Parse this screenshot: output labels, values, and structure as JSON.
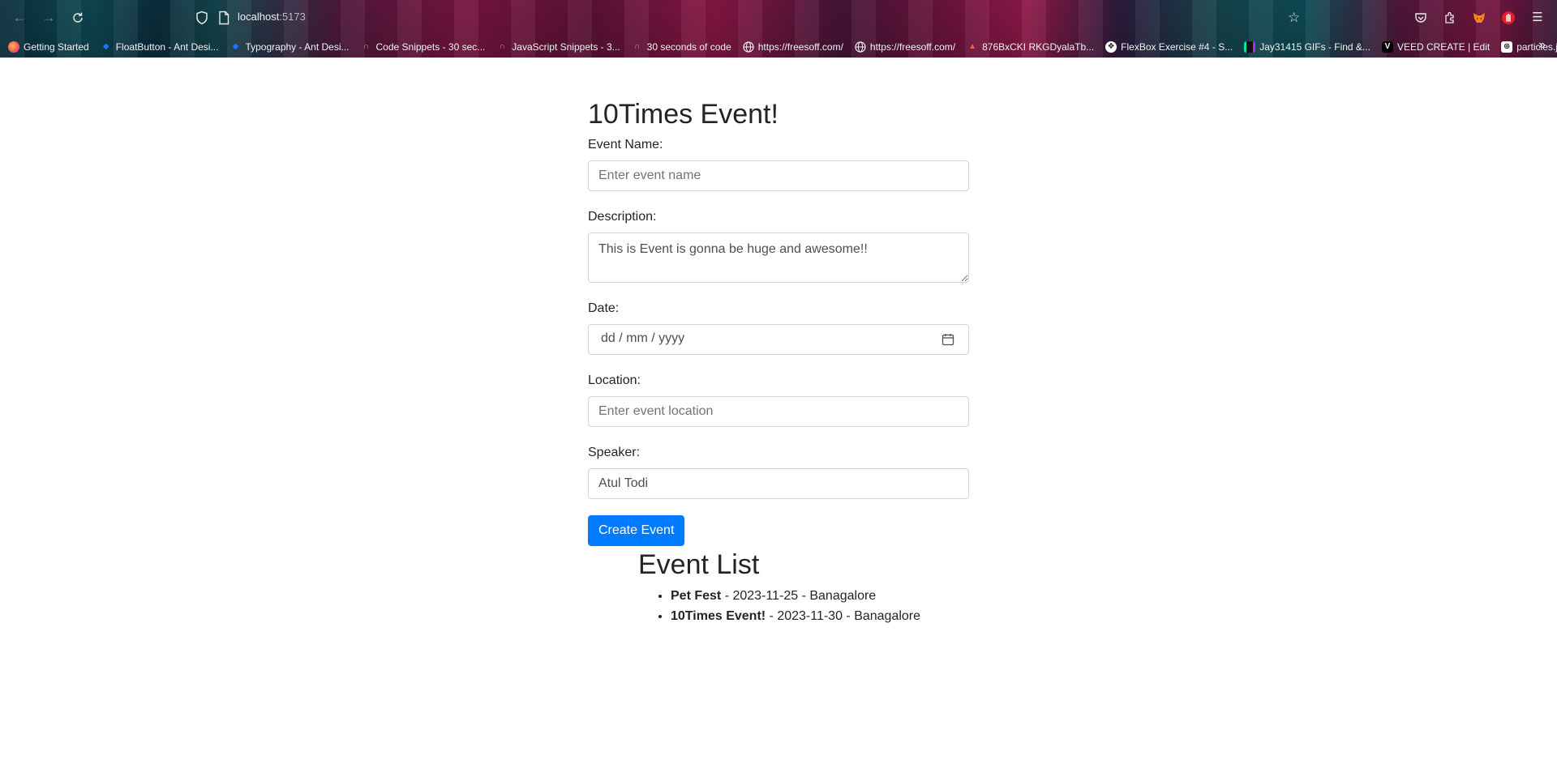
{
  "browser": {
    "url_host": "localhost",
    "url_port": ":5173",
    "bookmarks": [
      {
        "label": "Getting Started",
        "icon": "firefox-icon",
        "color": "#ff7139"
      },
      {
        "label": "FloatButton - Ant Desi...",
        "icon": "ant-design-icon",
        "color": "#1677ff"
      },
      {
        "label": "Typography - Ant Desi...",
        "icon": "ant-design-icon",
        "color": "#1677ff"
      },
      {
        "label": "Code Snippets - 30 sec...",
        "icon": "code-icon",
        "color": "#6b7cff"
      },
      {
        "label": "JavaScript Snippets - 3...",
        "icon": "code-icon",
        "color": "#6b7cff"
      },
      {
        "label": "30 seconds of code",
        "icon": "code-icon",
        "color": "#6b7cff"
      },
      {
        "label": "https://freesoff.com/",
        "icon": "globe-icon",
        "color": "#ffffff"
      },
      {
        "label": "https://freesoff.com/",
        "icon": "globe-icon",
        "color": "#ffffff"
      },
      {
        "label": "876BxCKI RKGDyalaTb...",
        "icon": "fire-icon",
        "color": "#ff4d2e"
      },
      {
        "label": "FlexBox Exercise #4 - S...",
        "icon": "flexbox-icon",
        "color": "#ffffff"
      },
      {
        "label": "Jay31415 GIFs - Find &...",
        "icon": "giphy-icon",
        "color": "#00e6a0"
      },
      {
        "label": "VEED CREATE | Edit",
        "icon": "veed-icon",
        "color": "#000000"
      },
      {
        "label": "particles.js",
        "icon": "particles-icon",
        "color": "#ffffff"
      }
    ]
  },
  "form": {
    "title": "10Times Event!",
    "event_name_label": "Event Name:",
    "event_name_placeholder": "Enter event name",
    "description_label": "Description:",
    "description_value": "This is Event is gonna be huge and awesome!!",
    "date_label": "Date:",
    "date_placeholder": "dd / mm / yyyy",
    "location_label": "Location:",
    "location_placeholder": "Enter event location",
    "speaker_label": "Speaker:",
    "speaker_value": "Atul Todi",
    "submit_label": "Create Event"
  },
  "event_list": {
    "title": "Event List",
    "items": [
      {
        "name": "Pet Fest",
        "details": " - 2023-11-25 - Banagalore"
      },
      {
        "name": "10Times Event!",
        "details": " - 2023-11-30 - Banagalore"
      }
    ]
  },
  "colors": {
    "primary": "#007bff",
    "text": "#212529"
  }
}
